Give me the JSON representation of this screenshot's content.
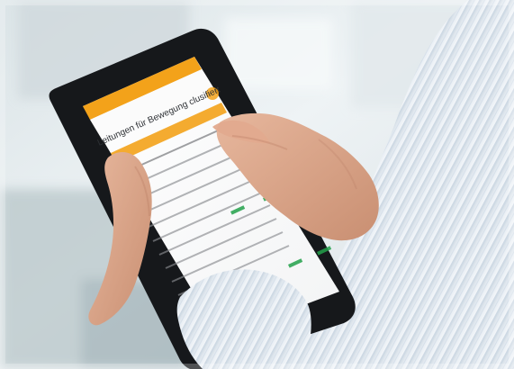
{
  "photo": {
    "subject": "tablet",
    "screen": {
      "headline": "Leitungen für Bewegung clusifiert"
    }
  },
  "colors": {
    "accent": "#f3a21a",
    "bezel": "#17191c",
    "shirt": "#dfe7f0",
    "skin": "#d9a688"
  }
}
